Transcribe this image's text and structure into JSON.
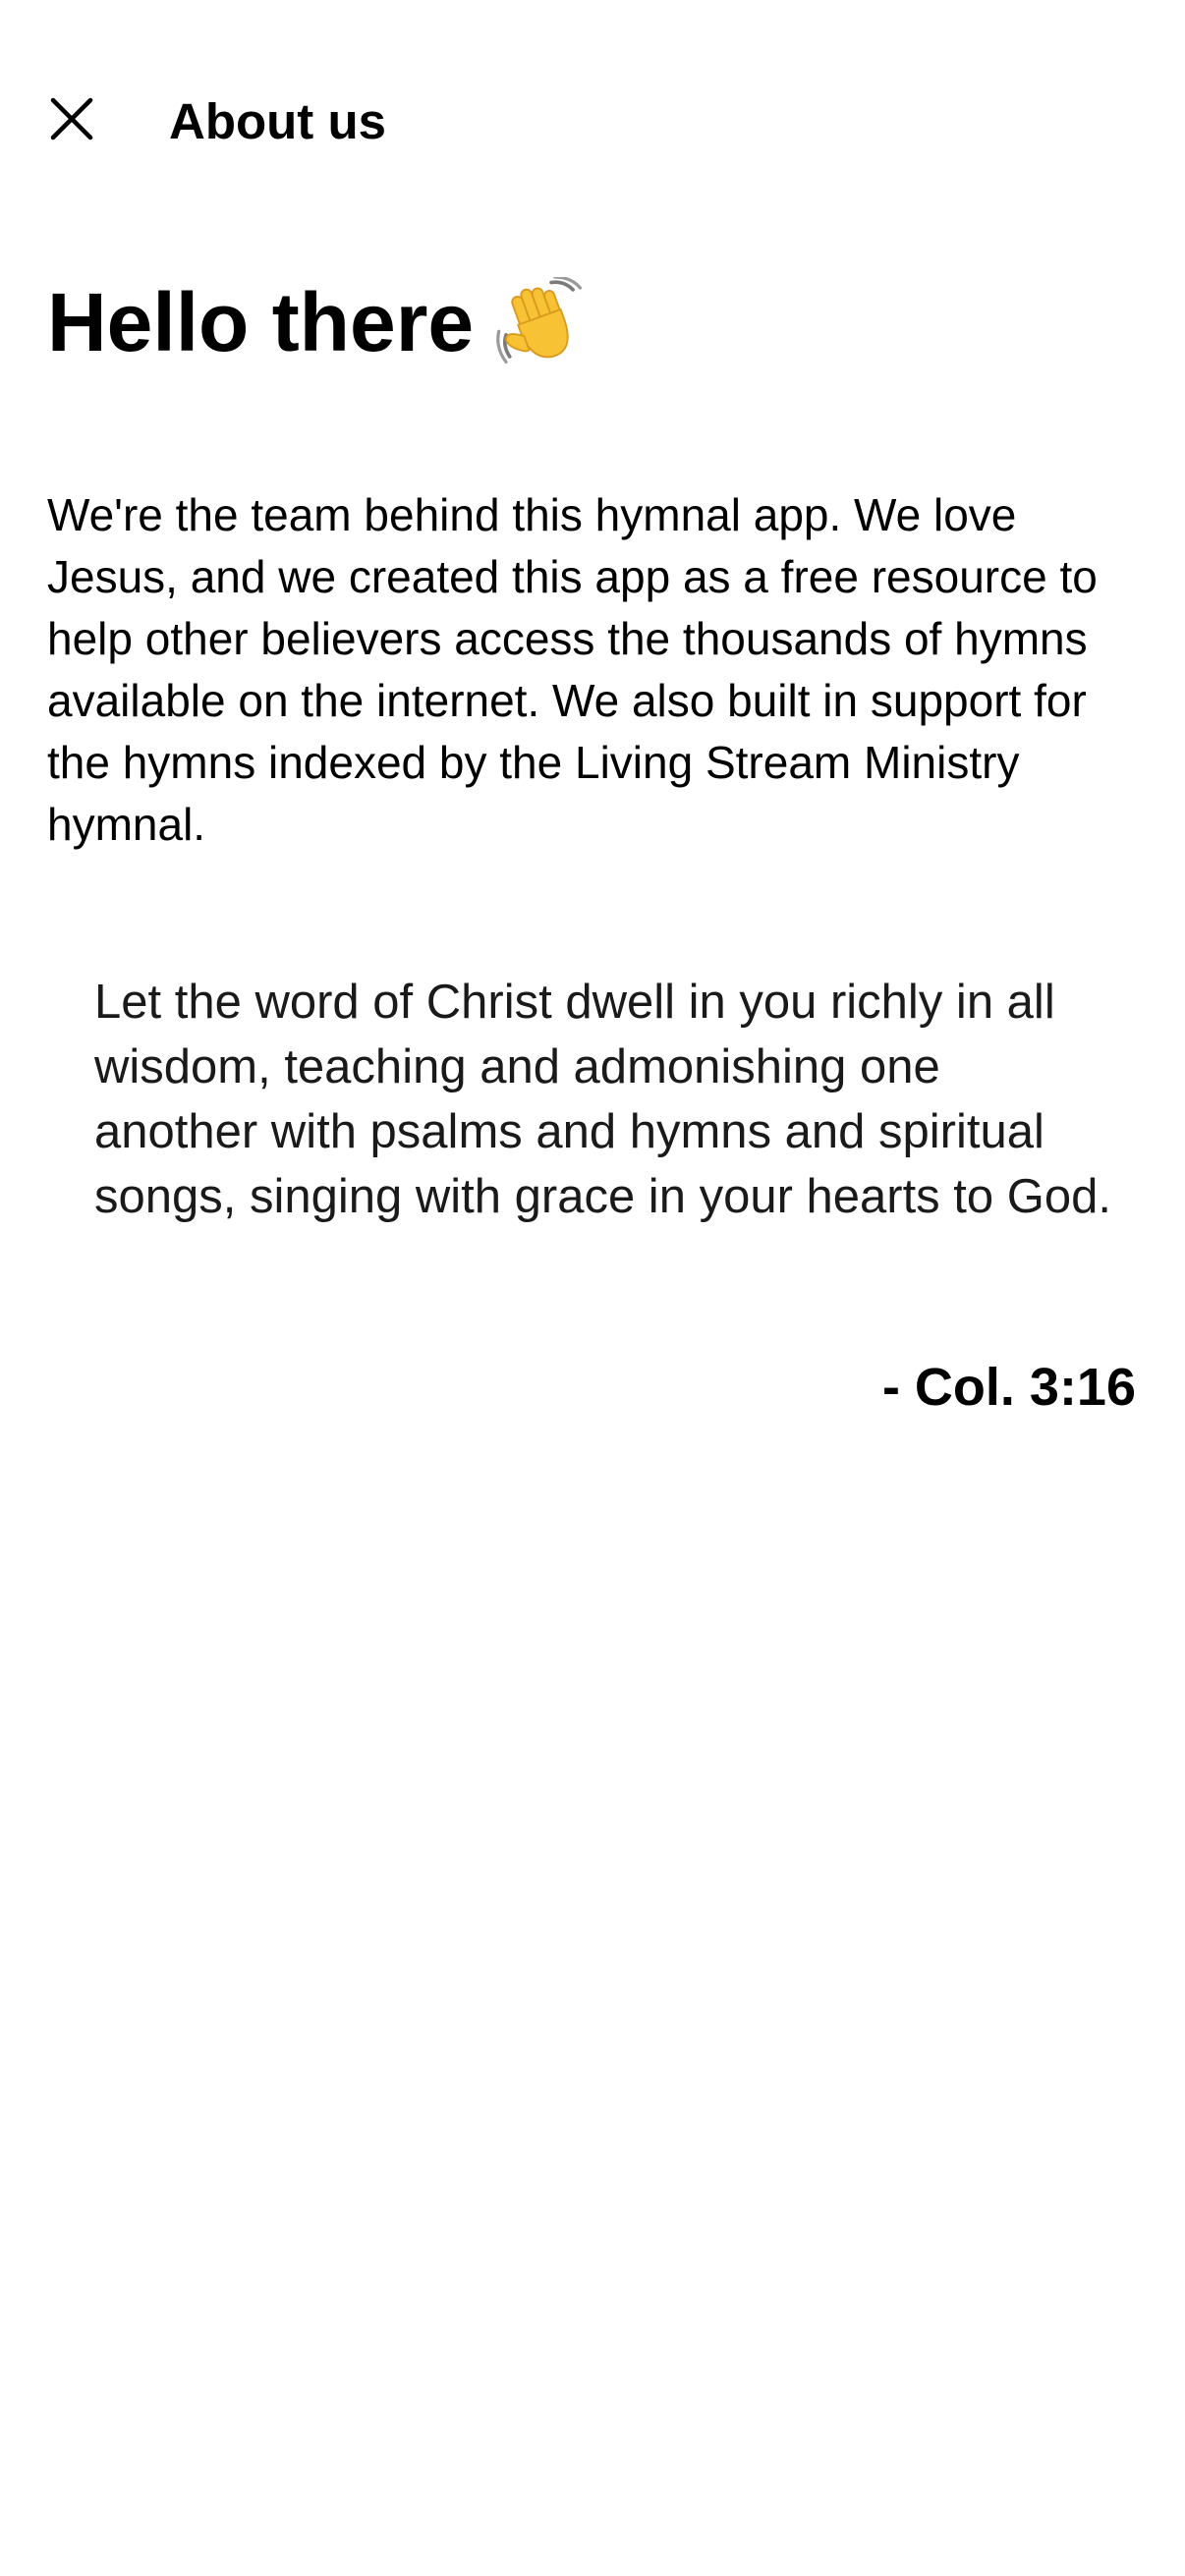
{
  "header": {
    "close_icon": "close-icon",
    "title": "About us"
  },
  "hero": {
    "greeting": "Hello there",
    "emoji_icon": "waving-hand-icon"
  },
  "intro": {
    "text": "We're the team behind this hymnal app. We love Jesus, and we created this app as a free resource to help other believers access the thousands of hymns available on the internet. We also built in support for the hymns indexed by the Living Stream Ministry hymnal."
  },
  "verse": {
    "quote": "Let the word of Christ dwell in you richly in all wisdom, teaching and admonishing one another with psalms and hymns and spiritual songs, singing with grace in your hearts to God.",
    "reference": "- Col. 3:16"
  },
  "colors": {
    "background": "#ffffff",
    "text": "#000000",
    "emoji": "#f7c233"
  }
}
